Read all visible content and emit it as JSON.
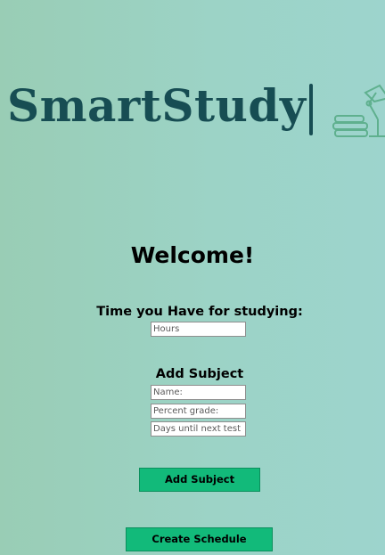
{
  "header": {
    "app_name": "SmartStudy",
    "logo_icon": "desk-lamp-books-icon"
  },
  "main": {
    "title": "Welcome!",
    "time_section": {
      "label": "Time you Have for studying:",
      "hours_placeholder": "Hours"
    },
    "subject_section": {
      "label": "Add Subject",
      "name_placeholder": "Name:",
      "grade_placeholder": "Percent grade:",
      "days_placeholder": "Days until next test"
    },
    "add_subject_label": "Add Subject",
    "create_schedule_label": "Create Schedule"
  },
  "colors": {
    "background_left": "#99cdb5",
    "background_right": "#9dd4cd",
    "logo_text": "#174d53",
    "logo_icon": "#5fb08e",
    "button": "#12ba7a"
  }
}
